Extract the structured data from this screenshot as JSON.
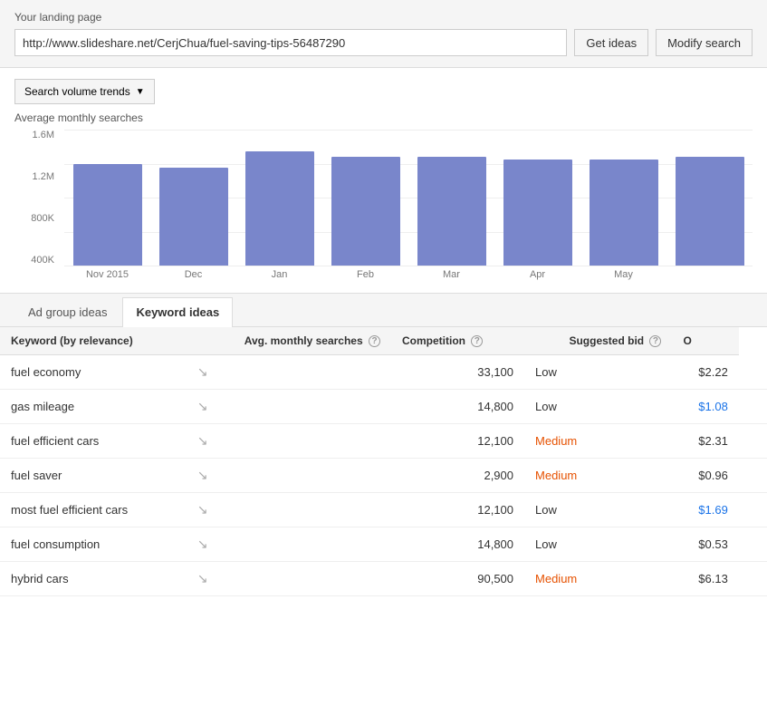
{
  "header": {
    "landing_label": "Your landing page",
    "url_value": "http://www.slideshare.net/CerjChua/fuel-saving-tips-56487290",
    "get_ideas_label": "Get ideas",
    "modify_search_label": "Modify search"
  },
  "chart": {
    "dropdown_label": "Search volume trends",
    "avg_label": "Average monthly searches",
    "y_labels": [
      "400K",
      "800K",
      "1.2M",
      "1.6M"
    ],
    "bars": [
      {
        "month": "Nov 2015",
        "height": 75
      },
      {
        "month": "Dec",
        "height": 72
      },
      {
        "month": "Jan",
        "height": 84
      },
      {
        "month": "Feb",
        "height": 80
      },
      {
        "month": "Mar",
        "height": 80
      },
      {
        "month": "Apr",
        "height": 78
      },
      {
        "month": "May",
        "height": 78
      },
      {
        "month": "",
        "height": 80
      }
    ]
  },
  "tabs": [
    {
      "label": "Ad group ideas",
      "active": false
    },
    {
      "label": "Keyword ideas",
      "active": true
    }
  ],
  "table": {
    "columns": [
      {
        "label": "Keyword (by relevance)",
        "key": "keyword",
        "has_help": false,
        "align": "left"
      },
      {
        "label": "Avg. monthly searches",
        "key": "searches",
        "has_help": true,
        "align": "right"
      },
      {
        "label": "Competition",
        "key": "competition",
        "has_help": true,
        "align": "left"
      },
      {
        "label": "Suggested bid",
        "key": "bid",
        "has_help": true,
        "align": "right"
      },
      {
        "label": "O",
        "key": "other",
        "has_help": false,
        "align": "left"
      }
    ],
    "rows": [
      {
        "keyword": "fuel economy",
        "searches": "33,100",
        "competition": "Low",
        "competition_class": "competition-low",
        "bid": "$2.22",
        "bid_link": false
      },
      {
        "keyword": "gas mileage",
        "searches": "14,800",
        "competition": "Low",
        "competition_class": "competition-low",
        "bid": "$1.08",
        "bid_link": true
      },
      {
        "keyword": "fuel efficient cars",
        "searches": "12,100",
        "competition": "Medium",
        "competition_class": "competition-medium",
        "bid": "$2.31",
        "bid_link": false
      },
      {
        "keyword": "fuel saver",
        "searches": "2,900",
        "competition": "Medium",
        "competition_class": "competition-medium",
        "bid": "$0.96",
        "bid_link": false
      },
      {
        "keyword": "most fuel efficient cars",
        "searches": "12,100",
        "competition": "Low",
        "competition_class": "competition-low",
        "bid": "$1.69",
        "bid_link": true
      },
      {
        "keyword": "fuel consumption",
        "searches": "14,800",
        "competition": "Low",
        "competition_class": "competition-low",
        "bid": "$0.53",
        "bid_link": false
      },
      {
        "keyword": "hybrid cars",
        "searches": "90,500",
        "competition": "Medium",
        "competition_class": "competition-medium",
        "bid": "$6.13",
        "bid_link": false
      }
    ]
  }
}
